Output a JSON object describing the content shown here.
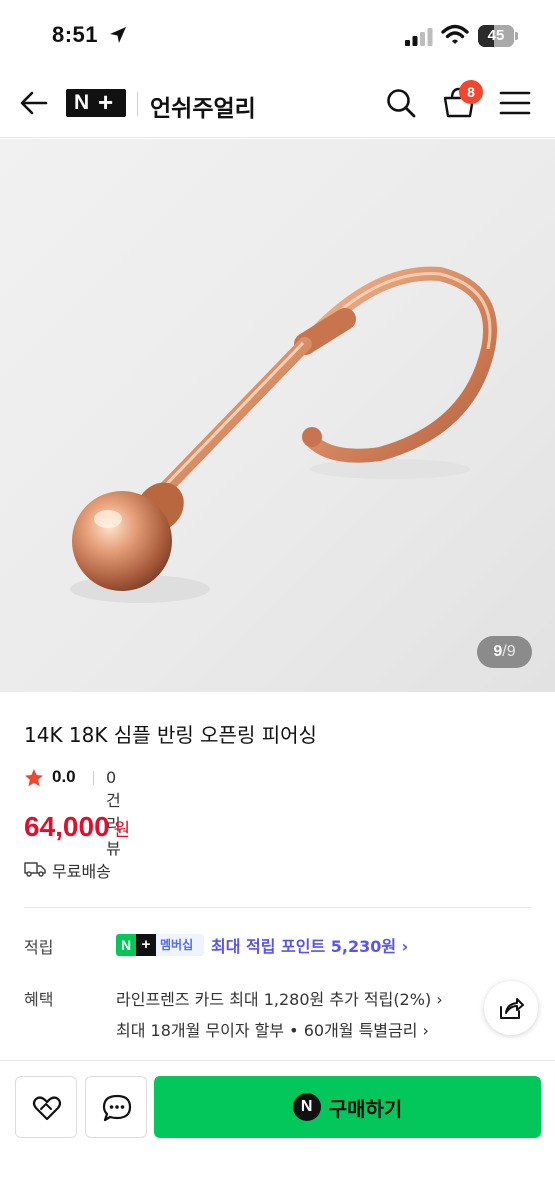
{
  "status_bar": {
    "time": "8:51",
    "battery": "45",
    "battery_level": 0.45,
    "icons": [
      "location-arrow-icon",
      "cellular-signal-icon",
      "wifi-icon",
      "battery-icon"
    ]
  },
  "header": {
    "logo_n": "N",
    "logo_plus": "+",
    "store_name": "언쉬주얼리",
    "cart_count": "8",
    "icons": [
      "back-arrow-icon",
      "search-icon",
      "cart-bag-icon",
      "menu-icon"
    ]
  },
  "gallery": {
    "current": "9",
    "separator": "/",
    "total": "9"
  },
  "product": {
    "title": "14K 18K 심플 반링 오픈링 피어싱",
    "rating": "0.0",
    "review_count": "0건 리뷰",
    "price": "64,000",
    "price_unit": "원",
    "shipping": "무료배송"
  },
  "benefits": {
    "points_label": "적립",
    "membership_n": "N",
    "membership_plus": "+",
    "membership_text": "멤버십",
    "points_text": "최대 적립 포인트 5,230원 ›",
    "benefit_label": "혜택",
    "benefit_line1": "라인프렌즈 카드 최대 1,280원 추가 적립(2%) ›",
    "benefit_line2": "최대 18개월 무이자 할부 • 60개월 특별금리 ›"
  },
  "bottom_bar": {
    "buy_n": "N",
    "buy_label": "구매하기"
  },
  "colors": {
    "price": "#e0102c",
    "naver_green": "#03c75a",
    "points_link": "#5a55e8",
    "badge": "#f2462e"
  }
}
